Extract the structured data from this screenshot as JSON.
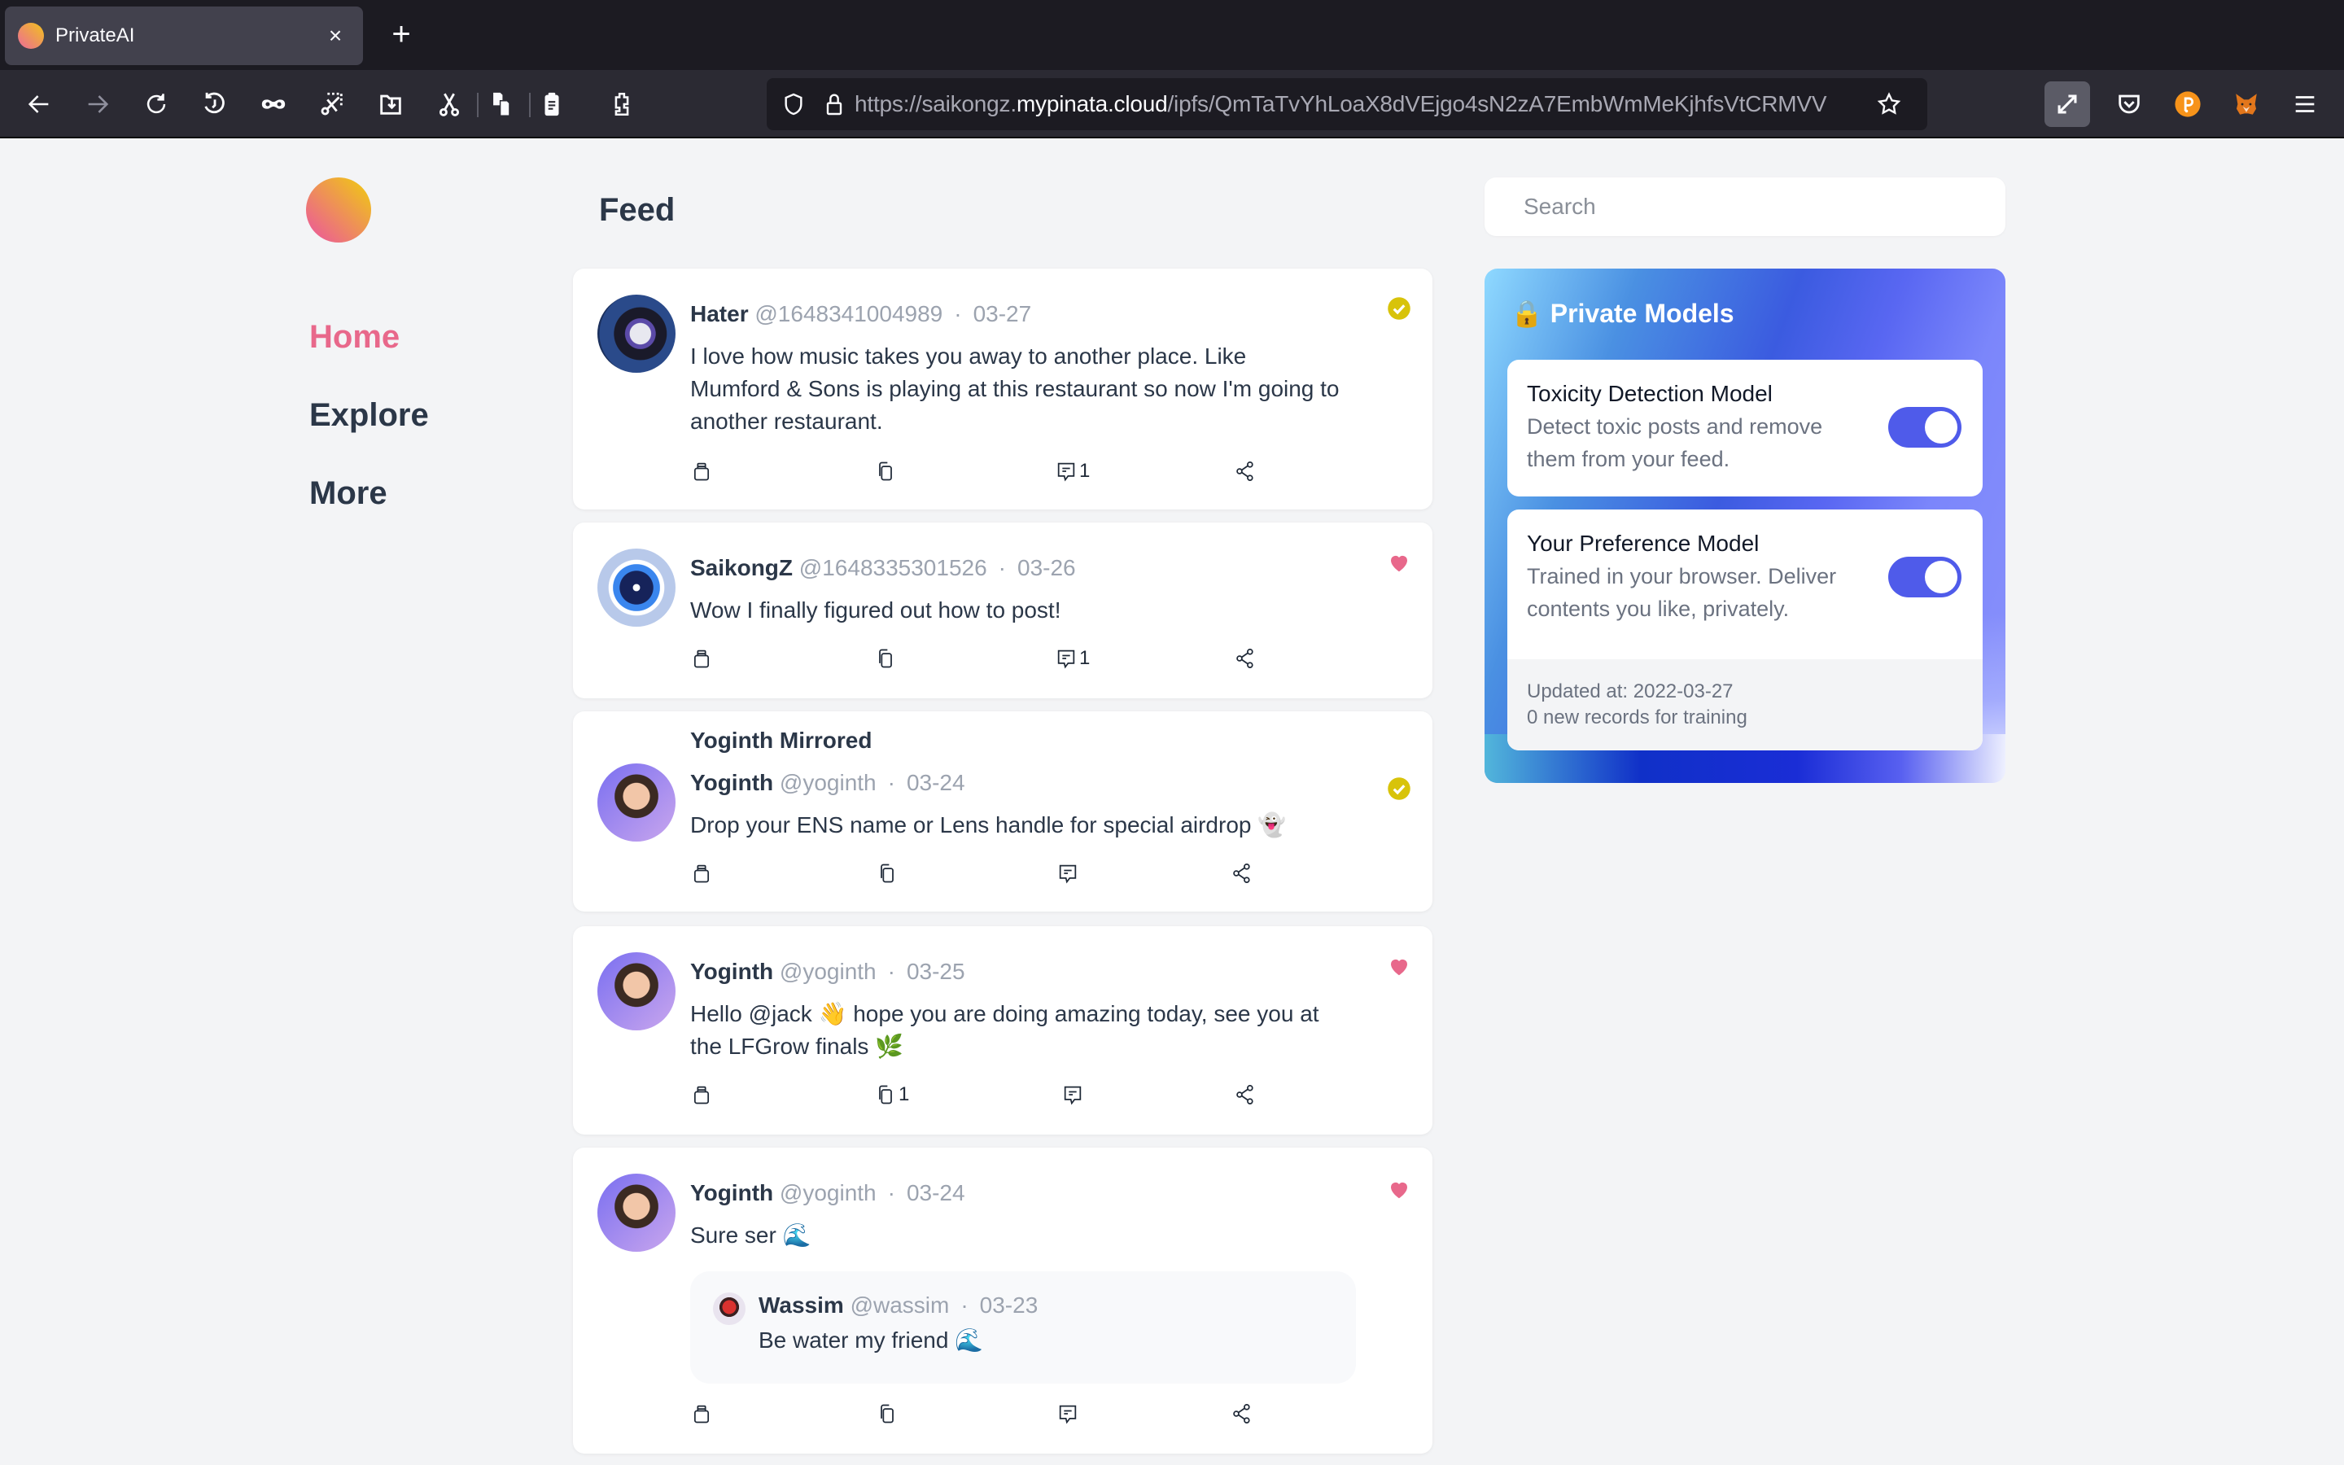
{
  "browser": {
    "tab_title": "PrivateAI",
    "tab_close": "×",
    "new_tab": "+",
    "url_prefix": "https://saikongz.",
    "url_host": "mypinata.cloud",
    "url_path": "/ipfs/QmTaTvYhLoaX8dVEjgo4sN2zA7EmbWmMeKjhfsVtCRMVV",
    "toolbar_icons": [
      "back-icon",
      "forward-icon",
      "reload-icon",
      "history-icon",
      "private-mask-icon",
      "screenshot-icon",
      "save-to-folder-icon",
      "cut-icon",
      "copy-icon",
      "paste-icon",
      "extensions-icon"
    ],
    "right_icons": [
      "fullscreen-icon",
      "pocket-icon",
      "polkadot-extension-icon",
      "metamask-icon",
      "menu-icon"
    ]
  },
  "sidebar": {
    "items": [
      {
        "label": "Home",
        "active": true
      },
      {
        "label": "Explore",
        "active": false
      },
      {
        "label": "More",
        "active": false
      }
    ]
  },
  "feed": {
    "title": "Feed",
    "posts": [
      {
        "name": "Hater",
        "handle": "@1648341004989",
        "date": "03-27",
        "body": "I love how music takes you away to another place. Like Mumford & Sons is playing at this restaurant so now I'm going to another restaurant.",
        "badge": "verified",
        "counts": {
          "collect": "",
          "mirror": "",
          "comment": "1",
          "share": ""
        }
      },
      {
        "name": "SaikongZ",
        "handle": "@1648335301526",
        "date": "03-26",
        "body": "Wow I finally figured out how to post!",
        "badge": "heart",
        "counts": {
          "collect": "",
          "mirror": "",
          "comment": "1",
          "share": ""
        }
      },
      {
        "mirror_label": "Yoginth Mirrored",
        "name": "Yoginth",
        "handle": "@yoginth",
        "date": "03-24",
        "body": "Drop your ENS name or Lens handle for special airdrop 👻",
        "badge": "verified",
        "counts": {
          "collect": "",
          "mirror": "",
          "comment": "",
          "share": ""
        }
      },
      {
        "name": "Yoginth",
        "handle": "@yoginth",
        "date": "03-25",
        "body": "Hello @jack 👋 hope you are doing amazing today, see you at the LFGrow finals 🌿",
        "badge": "heart",
        "counts": {
          "collect": "",
          "mirror": "1",
          "comment": "",
          "share": ""
        }
      },
      {
        "name": "Yoginth",
        "handle": "@yoginth",
        "date": "03-24",
        "body": "Sure ser 🌊",
        "badge": "heart",
        "quote": {
          "name": "Wassim",
          "handle": "@wassim",
          "date": "03-23",
          "body": "Be water my friend 🌊"
        },
        "counts": {
          "collect": "",
          "mirror": "",
          "comment": "",
          "share": ""
        }
      }
    ]
  },
  "search": {
    "placeholder": "Search",
    "value": ""
  },
  "private_models": {
    "title": "🔒 Private Models",
    "models": [
      {
        "name": "Toxicity Detection Model",
        "description": "Detect toxic posts and remove them from your feed.",
        "enabled": true
      },
      {
        "name": "Your Preference Model",
        "description": "Trained in your browser. Deliver contents you like, privately.",
        "enabled": true
      }
    ],
    "updated_at": "Updated at: 2022-03-27",
    "new_records": "0 new records for training"
  },
  "colors": {
    "accent_pink": "#e8688b",
    "text_dark": "#2b3748",
    "muted": "#9ca3af",
    "toggle_on": "#4f5bea",
    "verified_gold": "#d8c30a"
  }
}
